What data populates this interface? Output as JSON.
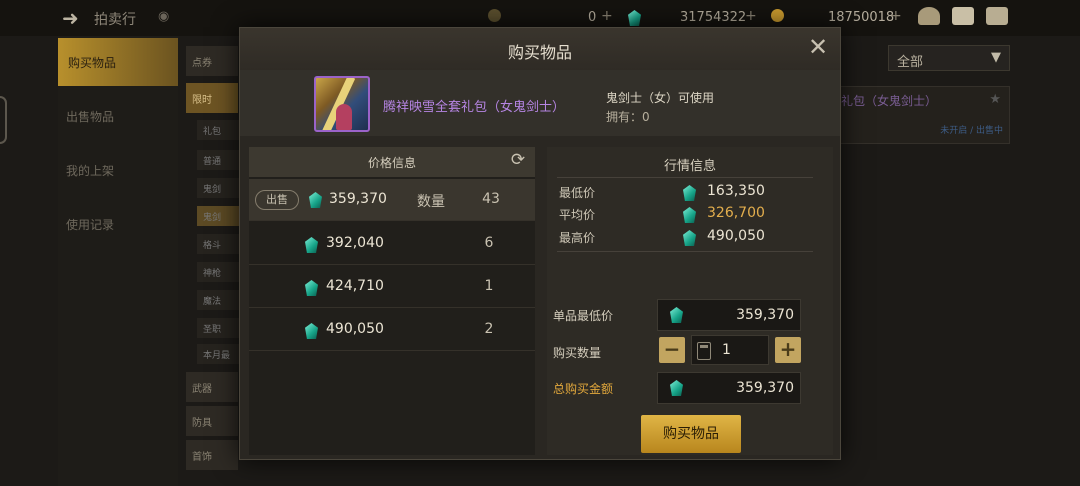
{
  "topbar": {
    "title": "拍卖行",
    "currency1": "0",
    "currency2": "31754322",
    "currency3": "18750018"
  },
  "left_menu": [
    "购买物品",
    "出售物品",
    "我的上架",
    "使用记录"
  ],
  "categories": [
    "点券",
    "限时",
    "武器",
    "防具",
    "首饰"
  ],
  "sub_tabs": [
    "礼包",
    "普通",
    "鬼剑",
    "鬼剑",
    "格斗",
    "神枪",
    "魔法",
    "圣职",
    "本月最"
  ],
  "bg_filter": {
    "label": "全部"
  },
  "bg_item": {
    "name": "礼包（女鬼剑士）",
    "status": "未开启 / 出售中"
  },
  "dialog": {
    "title": "购买物品",
    "item": {
      "name": "腾祥映雪全套礼包（女鬼剑士）",
      "usable": "鬼剑士（女）可使用",
      "owned": "拥有：0"
    },
    "price_info": {
      "header": "价格信息",
      "sell_tag": "出售",
      "qty_label": "数量",
      "listings": [
        {
          "price": "359,370",
          "qty": "43"
        },
        {
          "price": "392,040",
          "qty": "6"
        },
        {
          "price": "424,710",
          "qty": "1"
        },
        {
          "price": "490,050",
          "qty": "2"
        }
      ]
    },
    "market": {
      "header": "行情信息",
      "min_label": "最低价",
      "min_value": "163,350",
      "avg_label": "平均价",
      "avg_value": "326,700",
      "max_label": "最高价",
      "max_value": "490,050"
    },
    "order": {
      "unit_label": "单品最低价",
      "unit_value": "359,370",
      "qty_label": "购买数量",
      "qty_value": "1",
      "total_label": "总购买金额",
      "total_value": "359,370",
      "buy_label": "购买物品"
    }
  },
  "colors": {
    "accent_gold": "#e2a83c",
    "item_purple": "#b685e3",
    "gem": "#16a388"
  }
}
